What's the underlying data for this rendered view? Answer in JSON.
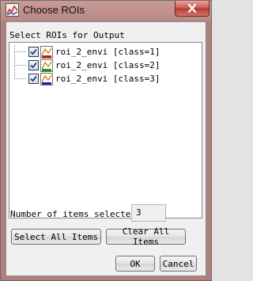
{
  "window": {
    "title": "Choose ROIs",
    "close_icon": "close-icon"
  },
  "list": {
    "label": "Select ROIs for Output",
    "items": [
      {
        "label": "roi_2_envi [class=1]",
        "checked": true,
        "color": "#cc1a1a"
      },
      {
        "label": "roi_2_envi [class=2]",
        "checked": true,
        "color": "#1a9a1a"
      },
      {
        "label": "roi_2_envi [class=3]",
        "checked": true,
        "color": "#1a1ac8"
      }
    ]
  },
  "count": {
    "label": "Number of items selected:",
    "value": "3"
  },
  "buttons": {
    "select_all": "Select All Items",
    "clear_all": "Clear All Items",
    "ok": "OK",
    "cancel": "Cancel"
  }
}
